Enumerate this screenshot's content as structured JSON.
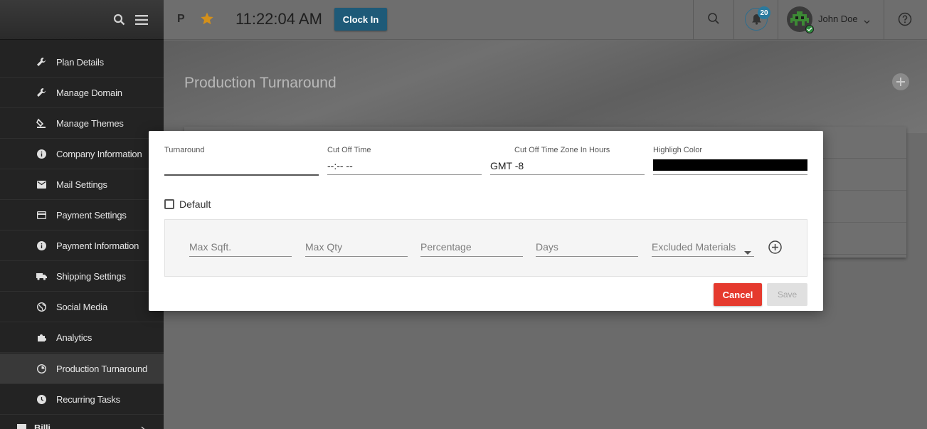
{
  "sidebar": {
    "items": [
      {
        "label": "Plan Details",
        "icon": "wrench-icon"
      },
      {
        "label": "Manage Domain",
        "icon": "wrench-icon"
      },
      {
        "label": "Manage Themes",
        "icon": "paint-bucket-icon"
      },
      {
        "label": "Company Information",
        "icon": "info-icon"
      },
      {
        "label": "Mail Settings",
        "icon": "mail-icon"
      },
      {
        "label": "Payment Settings",
        "icon": "credit-card-icon"
      },
      {
        "label": "Payment Information",
        "icon": "info-icon"
      },
      {
        "label": "Shipping Settings",
        "icon": "truck-icon"
      },
      {
        "label": "Social Media",
        "icon": "globe-icon"
      },
      {
        "label": "Analytics",
        "icon": "puzzle-icon"
      },
      {
        "label": "Production Turnaround",
        "icon": "pie-icon"
      },
      {
        "label": "Recurring Tasks",
        "icon": "clock-icon"
      },
      {
        "label": "Billi",
        "icon": "billing-icon"
      }
    ]
  },
  "topbar": {
    "initial": "P",
    "time": "11:22:04 AM",
    "clock_in_label": "Clock In",
    "notification_count": "20",
    "user_name": "John Doe"
  },
  "page": {
    "title": "Production Turnaround"
  },
  "modal": {
    "turnaround_label": "Turnaround",
    "turnaround_value": "",
    "cutoff_label": "Cut Off Time",
    "cutoff_value": "--:-- --",
    "timezone_label": "Cut Off Time Zone In Hours",
    "timezone_value": "GMT -8",
    "highlight_label": "Highligh Color",
    "highlight_color": "#000000",
    "default_label": "Default",
    "rule": {
      "max_sqft": "Max Sqft.",
      "max_qty": "Max Qty",
      "percentage": "Percentage",
      "days": "Days",
      "excluded": "Excluded Materials"
    },
    "cancel_label": "Cancel",
    "save_label": "Save"
  },
  "colors": {
    "accent": "#1e5a78",
    "cancel": "#e53a2e",
    "status_online": "#2e8b3d"
  }
}
